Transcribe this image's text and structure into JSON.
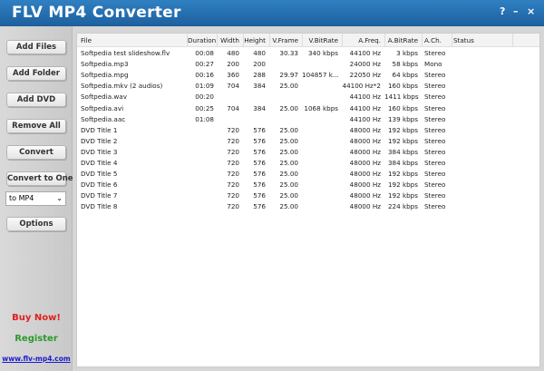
{
  "window": {
    "title": "FLV MP4 Converter",
    "help": "?",
    "minimize": "–",
    "close": "×"
  },
  "sidebar": {
    "buttons": [
      "Add Files",
      "Add Folder",
      "Add DVD",
      "Remove All",
      "Convert",
      "Convert to One"
    ],
    "format": "to MP4",
    "options": "Options",
    "buy": "Buy Now!",
    "register": "Register",
    "website": "www.flv-mp4.com",
    "colors": {
      "buy": "#e0201c",
      "register": "#2a9a2a",
      "website": "#1a1acc"
    }
  },
  "table": {
    "columns": [
      "File",
      "Duration",
      "Width",
      "Height",
      "V.Frame",
      "V.BitRate",
      "A.Freq.",
      "A.BitRate",
      "A.Ch.",
      "Status"
    ],
    "rows": [
      [
        "Softpedia test slideshow.flv",
        "00:08",
        "480",
        "480",
        "30.33",
        "340 kbps",
        "44100 Hz",
        "3 kbps",
        "Stereo",
        ""
      ],
      [
        "Softpedia.mp3",
        "00:27",
        "200",
        "200",
        "",
        "",
        "24000 Hz",
        "58 kbps",
        "Mono",
        ""
      ],
      [
        "Softpedia.mpg",
        "00:16",
        "360",
        "288",
        "29.97",
        "104857 k...",
        "22050 Hz",
        "64 kbps",
        "Stereo",
        ""
      ],
      [
        "Softpedia.mkv (2 audios)",
        "01:09",
        "704",
        "384",
        "25.00",
        "",
        "44100 Hz*2",
        "160 kbps",
        "Stereo",
        ""
      ],
      [
        "Softpedia.wav",
        "00:20",
        "",
        "",
        "",
        "",
        "44100 Hz",
        "1411 kbps",
        "Stereo",
        ""
      ],
      [
        "Softpedia.avi",
        "00:25",
        "704",
        "384",
        "25.00",
        "1068 kbps",
        "44100 Hz",
        "160 kbps",
        "Stereo",
        ""
      ],
      [
        "Softpedia.aac",
        "01:08",
        "",
        "",
        "",
        "",
        "44100 Hz",
        "139 kbps",
        "Stereo",
        ""
      ],
      [
        "DVD Title 1",
        "",
        "720",
        "576",
        "25.00",
        "",
        "48000 Hz",
        "192 kbps",
        "Stereo",
        ""
      ],
      [
        "DVD Title 2",
        "",
        "720",
        "576",
        "25.00",
        "",
        "48000 Hz",
        "192 kbps",
        "Stereo",
        ""
      ],
      [
        "DVD Title 3",
        "",
        "720",
        "576",
        "25.00",
        "",
        "48000 Hz",
        "384 kbps",
        "Stereo",
        ""
      ],
      [
        "DVD Title 4",
        "",
        "720",
        "576",
        "25.00",
        "",
        "48000 Hz",
        "384 kbps",
        "Stereo",
        ""
      ],
      [
        "DVD Title 5",
        "",
        "720",
        "576",
        "25.00",
        "",
        "48000 Hz",
        "192 kbps",
        "Stereo",
        ""
      ],
      [
        "DVD Title 6",
        "",
        "720",
        "576",
        "25.00",
        "",
        "48000 Hz",
        "192 kbps",
        "Stereo",
        ""
      ],
      [
        "DVD Title 7",
        "",
        "720",
        "576",
        "25.00",
        "",
        "48000 Hz",
        "192 kbps",
        "Stereo",
        ""
      ],
      [
        "DVD Title 8",
        "",
        "720",
        "576",
        "25.00",
        "",
        "48000 Hz",
        "224 kbps",
        "Stereo",
        ""
      ]
    ]
  }
}
